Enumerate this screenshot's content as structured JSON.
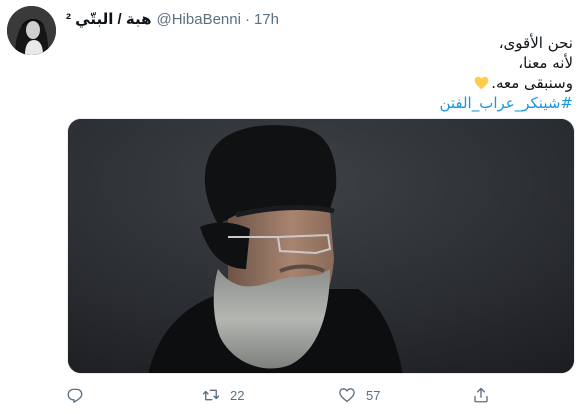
{
  "tweet": {
    "author": {
      "display_name": "هبة / البتّي ²",
      "handle": "@HibaBenni",
      "avatar_icon": "profile-photo"
    },
    "separator": "·",
    "time": "17h",
    "text_lines": [
      "نحن الأقوى،",
      "لأنه معنا،",
      "وسنبقى معه."
    ],
    "emoji": "yellow-heart",
    "hashtag": "#شينكر_عراب_الفتن",
    "media": {
      "description_icon": "photo"
    },
    "actions": {
      "reply": {
        "icon": "reply-icon",
        "count": ""
      },
      "retweet": {
        "icon": "retweet-icon",
        "count": "22"
      },
      "like": {
        "icon": "heart-icon",
        "count": "57"
      },
      "share": {
        "icon": "share-icon",
        "count": ""
      }
    }
  },
  "colors": {
    "link": "#1b95e0",
    "secondary_text": "#5b7083",
    "emoji_yellow": "#ffcc4d"
  }
}
